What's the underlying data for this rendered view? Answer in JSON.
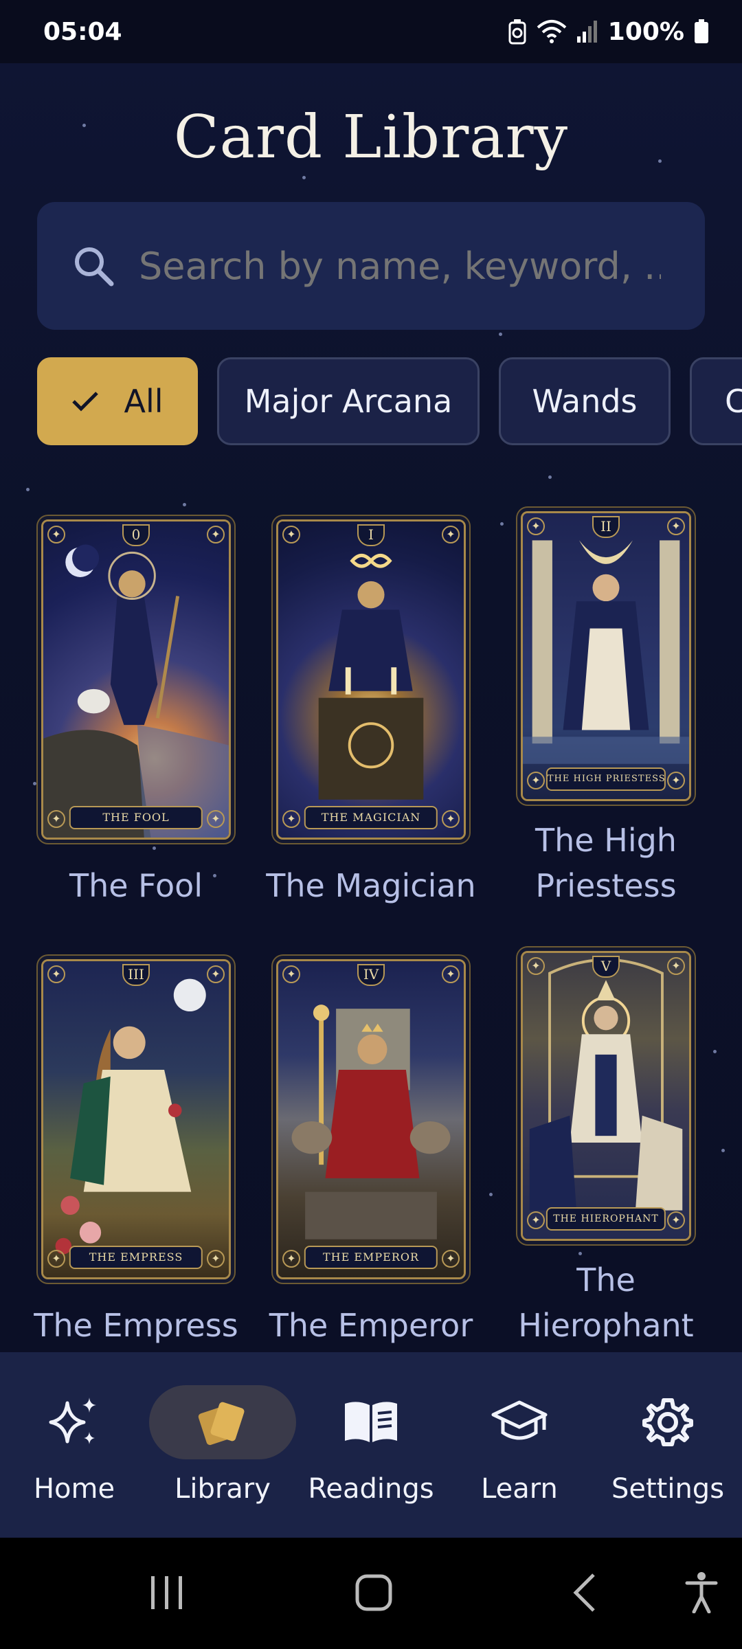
{
  "status": {
    "time": "05:04",
    "battery": "100%"
  },
  "page": {
    "title": "Card Library"
  },
  "search": {
    "placeholder": "Search by name, keyword, ..."
  },
  "filters": [
    {
      "label": "All",
      "selected": true
    },
    {
      "label": "Major Arcana",
      "selected": false
    },
    {
      "label": "Wands",
      "selected": false
    },
    {
      "label": "C",
      "selected": false
    }
  ],
  "cards": [
    {
      "name": "The Fool",
      "numeral": "0",
      "plate": "THE FOOL"
    },
    {
      "name": "The Magician",
      "numeral": "I",
      "plate": "THE MAGICIAN"
    },
    {
      "name": "The High Priestess",
      "numeral": "II",
      "plate": "THE HIGH PRIESTESS"
    },
    {
      "name": "The Empress",
      "numeral": "III",
      "plate": "THE EMPRESS"
    },
    {
      "name": "The Emperor",
      "numeral": "IV",
      "plate": "THE EMPEROR"
    },
    {
      "name": "The Hierophant",
      "numeral": "V",
      "plate": "THE HIEROPHANT"
    }
  ],
  "nav": [
    {
      "label": "Home",
      "icon": "sparkles-icon",
      "active": false
    },
    {
      "label": "Library",
      "icon": "cards-icon",
      "active": true
    },
    {
      "label": "Readings",
      "icon": "book-icon",
      "active": false
    },
    {
      "label": "Learn",
      "icon": "graduation-cap-icon",
      "active": false
    },
    {
      "label": "Settings",
      "icon": "gear-icon",
      "active": false
    }
  ],
  "colors": {
    "accent": "#d2a94f",
    "background": "#0b0f26",
    "surface": "#1c2650",
    "nav": "#1b2347"
  }
}
